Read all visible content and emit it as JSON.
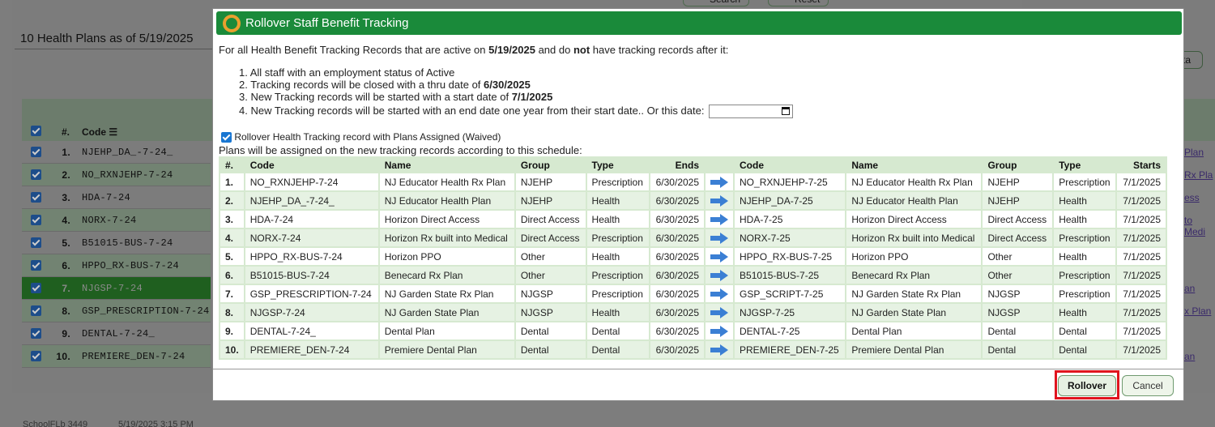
{
  "background": {
    "title": "10 Health Plans as of 5/19/2025",
    "top_buttons": [
      "Search",
      "Reset"
    ],
    "right_button": "ta",
    "columns": {
      "num": "#.",
      "code": "Code"
    },
    "rows": [
      {
        "num": "1.",
        "code": "NJEHP_DA_-7-24_"
      },
      {
        "num": "2.",
        "code": "NO_RXNJEHP-7-24"
      },
      {
        "num": "3.",
        "code": "HDA-7-24"
      },
      {
        "num": "4.",
        "code": "NORX-7-24"
      },
      {
        "num": "5.",
        "code": "B51015-BUS-7-24"
      },
      {
        "num": "6.",
        "code": "HPPO_RX-BUS-7-24"
      },
      {
        "num": "7.",
        "code": "NJGSP-7-24"
      },
      {
        "num": "8.",
        "code": "GSP_PRESCRIPTION-7-24"
      },
      {
        "num": "9.",
        "code": "DENTAL-7-24_"
      },
      {
        "num": "10.",
        "code": "PREMIERE_DEN-7-24"
      }
    ],
    "right_links": [
      "Plan",
      "Rx Pla",
      "ess",
      "to Medi",
      "an",
      "x Plan",
      "an"
    ],
    "footer": {
      "left": "SchoolFLb 3449",
      "right": "5/19/2025 3:15 PM"
    }
  },
  "dialog": {
    "title": "Rollover Staff Benefit Tracking",
    "intro": {
      "pre": "For all Health Benefit Tracking Records that are active on ",
      "date": "5/19/2025",
      "mid": " and do ",
      "not": "not",
      "post": " have tracking records after it:"
    },
    "steps": {
      "s1": "1. All staff with an employment status of Active",
      "s2_pre": "2. Tracking records will be closed with a thru date of ",
      "s2_date": "6/30/2025",
      "s3_pre": "3. New Tracking records will be started with a start date of ",
      "s3_date": "7/1/2025",
      "s4": "4. New Tracking records will be started with an end date one year from their start date.. Or this date:"
    },
    "end_date_value": "",
    "waived_checkbox_label": "Rollover Health Tracking record with Plans Assigned (Waived)",
    "schedule_text": "Plans will be assigned on the new tracking records according to this schedule:",
    "table_headers": {
      "num": "#.",
      "code": "Code",
      "name": "Name",
      "group": "Group",
      "type": "Type",
      "ends": "Ends",
      "new_code": "Code",
      "new_name": "Name",
      "new_group": "Group",
      "new_type": "Type",
      "starts": "Starts"
    },
    "plans": [
      {
        "num": "1.",
        "code": "NO_RXNJEHP-7-24",
        "name": "NJ Educator Health Rx Plan",
        "group": "NJEHP",
        "type": "Prescription",
        "ends": "6/30/2025",
        "new_code": "NO_RXNJEHP-7-25",
        "new_name": "NJ Educator Health Rx Plan",
        "new_group": "NJEHP",
        "new_type": "Prescription",
        "starts": "7/1/2025"
      },
      {
        "num": "2.",
        "code": "NJEHP_DA_-7-24_",
        "name": "NJ Educator Health Plan",
        "group": "NJEHP",
        "type": "Health",
        "ends": "6/30/2025",
        "new_code": "NJEHP_DA-7-25",
        "new_name": "NJ Educator Health Plan",
        "new_group": "NJEHP",
        "new_type": "Health",
        "starts": "7/1/2025"
      },
      {
        "num": "3.",
        "code": "HDA-7-24",
        "name": "Horizon Direct Access",
        "group": "Direct Access",
        "type": "Health",
        "ends": "6/30/2025",
        "new_code": "HDA-7-25",
        "new_name": "Horizon Direct Access",
        "new_group": "Direct Access",
        "new_type": "Health",
        "starts": "7/1/2025"
      },
      {
        "num": "4.",
        "code": "NORX-7-24",
        "name": "Horizon Rx built into Medical",
        "group": "Direct Access",
        "type": "Prescription",
        "ends": "6/30/2025",
        "new_code": "NORX-7-25",
        "new_name": "Horizon Rx built into Medical",
        "new_group": "Direct Access",
        "new_type": "Prescription",
        "starts": "7/1/2025"
      },
      {
        "num": "5.",
        "code": "HPPO_RX-BUS-7-24",
        "name": "Horizon PPO",
        "group": "Other",
        "type": "Health",
        "ends": "6/30/2025",
        "new_code": "HPPO_RX-BUS-7-25",
        "new_name": "Horizon PPO",
        "new_group": "Other",
        "new_type": "Health",
        "starts": "7/1/2025"
      },
      {
        "num": "6.",
        "code": "B51015-BUS-7-24",
        "name": "Benecard Rx Plan",
        "group": "Other",
        "type": "Prescription",
        "ends": "6/30/2025",
        "new_code": "B51015-BUS-7-25",
        "new_name": "Benecard Rx Plan",
        "new_group": "Other",
        "new_type": "Prescription",
        "starts": "7/1/2025"
      },
      {
        "num": "7.",
        "code": "GSP_PRESCRIPTION-7-24",
        "name": "NJ Garden State Rx Plan",
        "group": "NJGSP",
        "type": "Prescription",
        "ends": "6/30/2025",
        "new_code": "GSP_SCRIPT-7-25",
        "new_name": "NJ Garden State Rx Plan",
        "new_group": "NJGSP",
        "new_type": "Prescription",
        "starts": "7/1/2025"
      },
      {
        "num": "8.",
        "code": "NJGSP-7-24",
        "name": "NJ Garden State Plan",
        "group": "NJGSP",
        "type": "Health",
        "ends": "6/30/2025",
        "new_code": "NJGSP-7-25",
        "new_name": "NJ Garden State Plan",
        "new_group": "NJGSP",
        "new_type": "Health",
        "starts": "7/1/2025"
      },
      {
        "num": "9.",
        "code": "DENTAL-7-24_",
        "name": "Dental Plan",
        "group": "Dental",
        "type": "Dental",
        "ends": "6/30/2025",
        "new_code": "DENTAL-7-25",
        "new_name": "Dental Plan",
        "new_group": "Dental",
        "new_type": "Dental",
        "starts": "7/1/2025"
      },
      {
        "num": "10.",
        "code": "PREMIERE_DEN-7-24",
        "name": "Premiere Dental Plan",
        "group": "Dental",
        "type": "Dental",
        "ends": "6/30/2025",
        "new_code": "PREMIERE_DEN-7-25",
        "new_name": "Premiere Dental Plan",
        "new_group": "Dental",
        "new_type": "Dental",
        "starts": "7/1/2025"
      }
    ],
    "buttons": {
      "rollover": "Rollover",
      "cancel": "Cancel"
    },
    "colors": {
      "title_bar": "#1a8a3a",
      "highlight": "#e0141e",
      "arrow": "#3b7fd4"
    }
  }
}
